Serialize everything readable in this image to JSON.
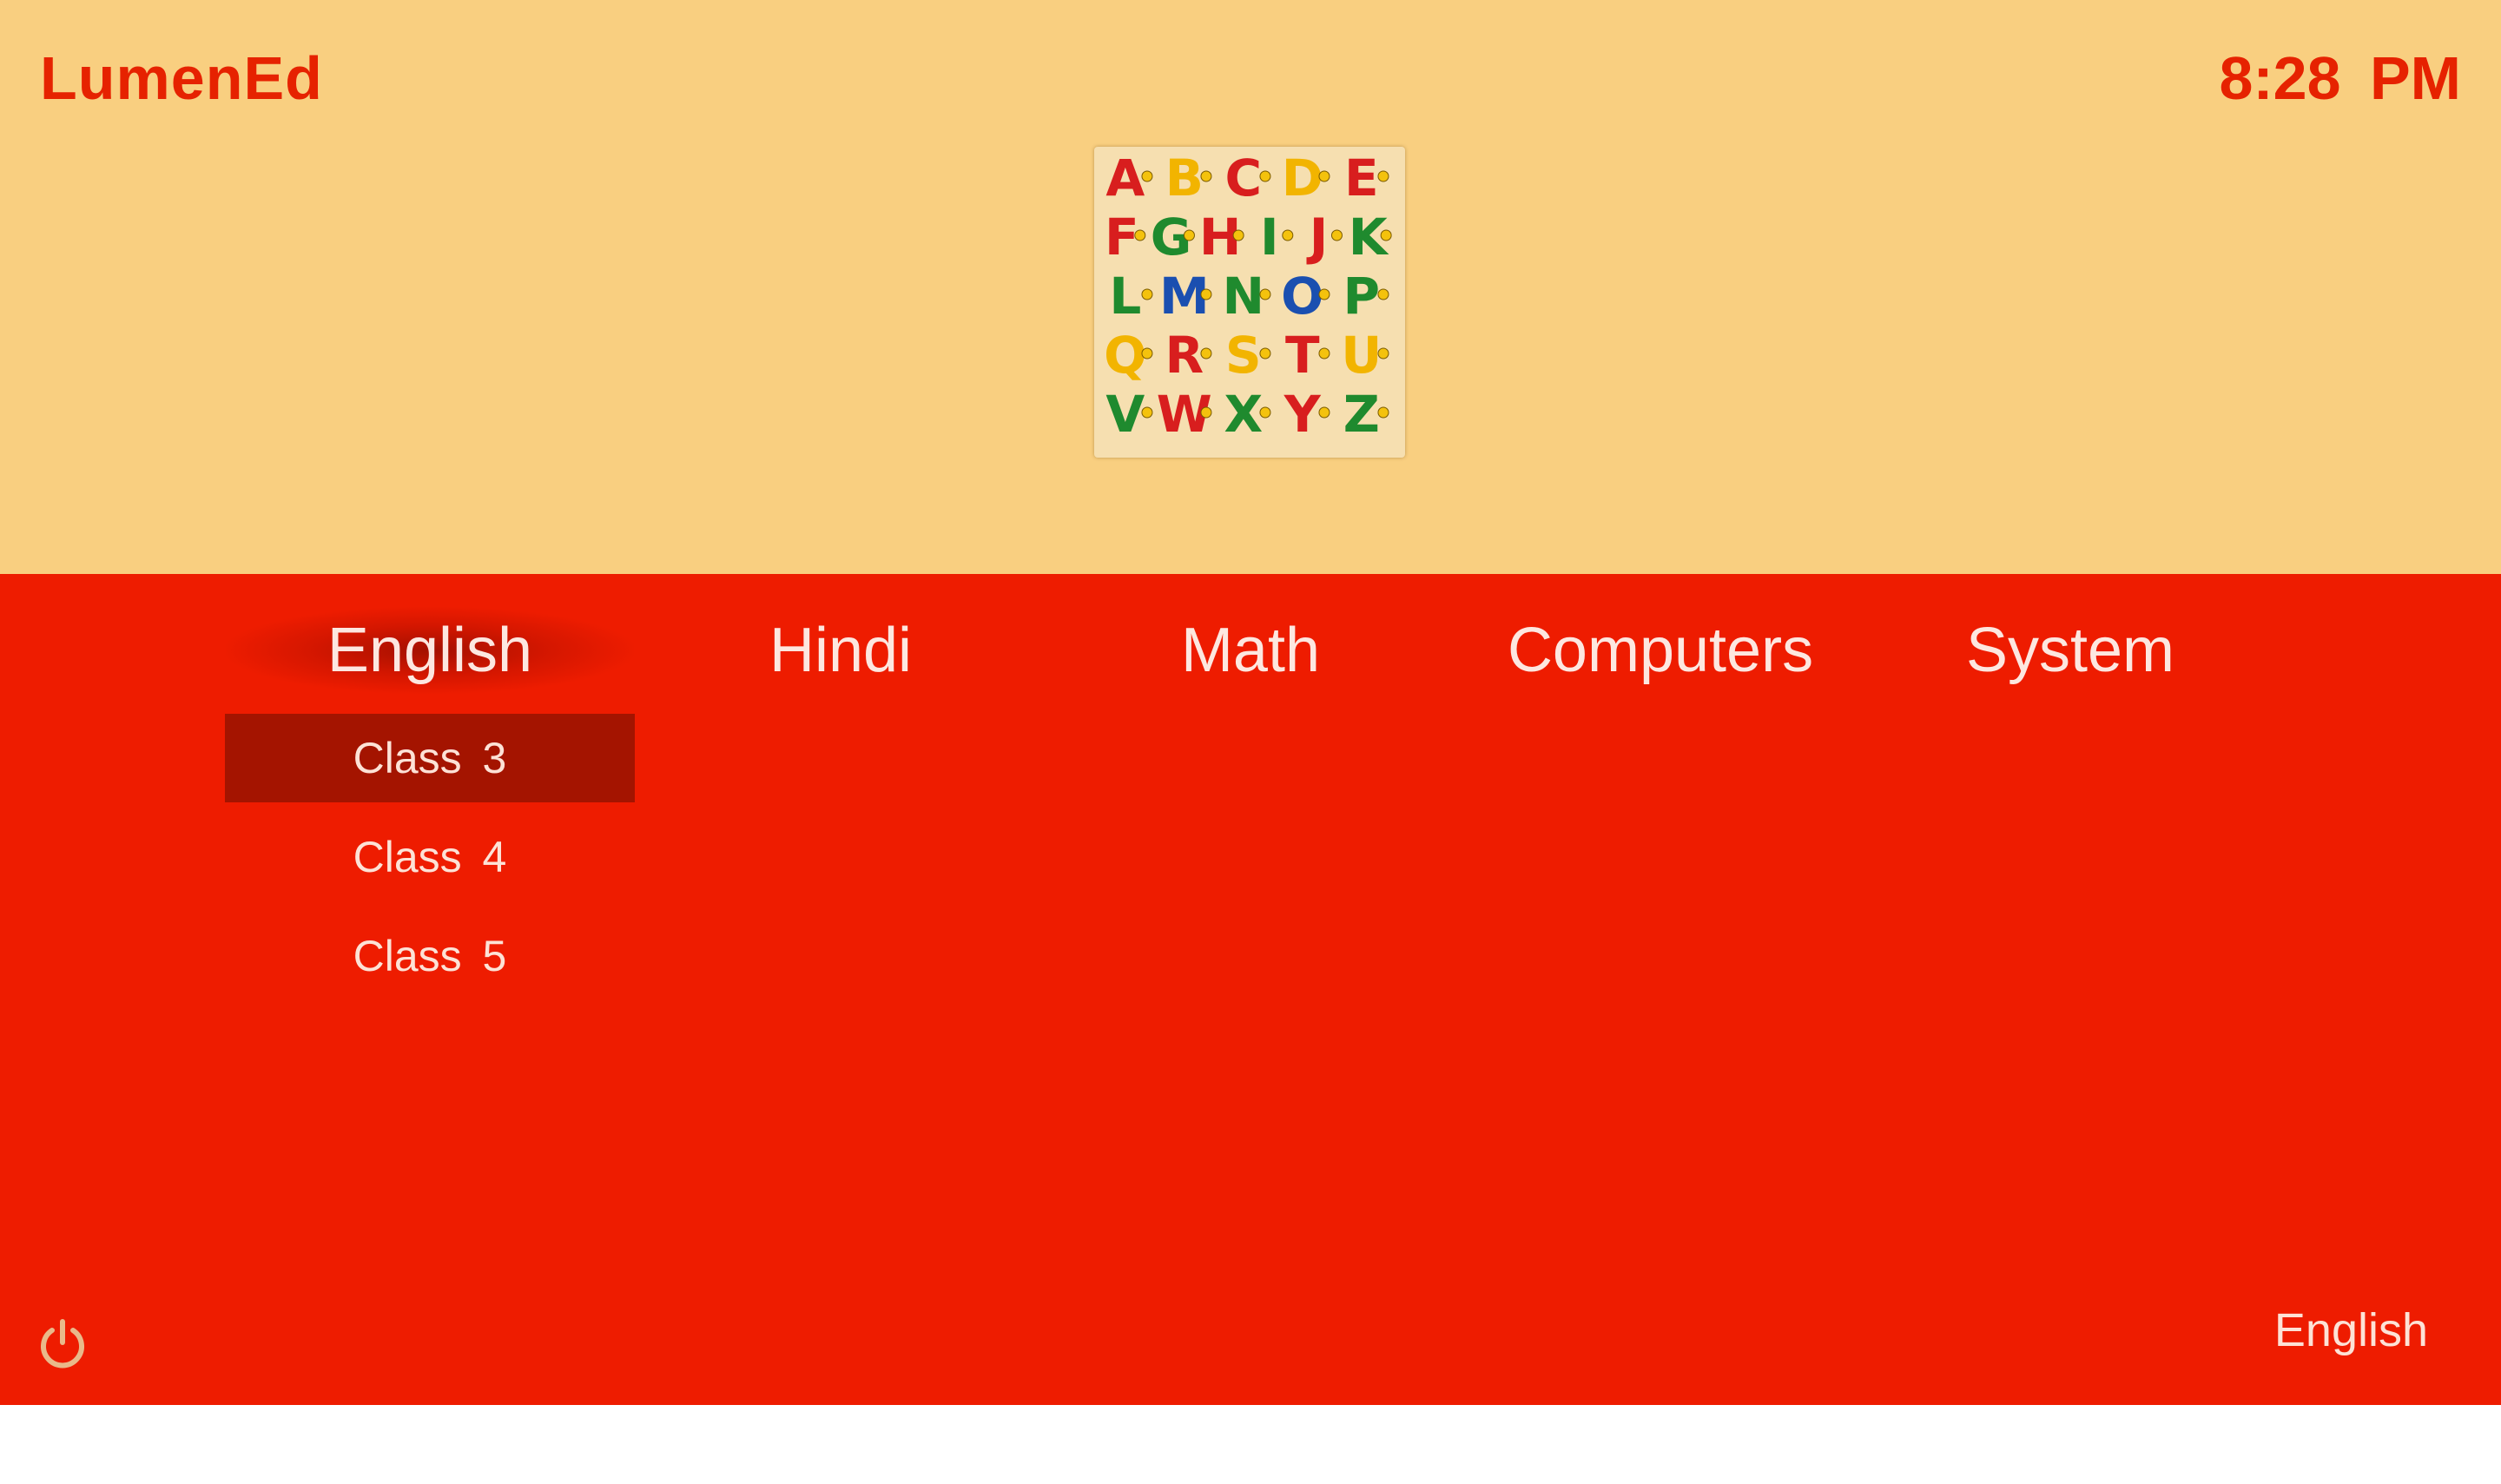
{
  "header": {
    "brand": "LumenEd",
    "time": "8:28 PM",
    "banner_icon": "alphabet-puzzle-image",
    "banner_letters": [
      "A",
      "B",
      "C",
      "D",
      "E",
      "F",
      "G",
      "H",
      "I",
      "J",
      "K",
      "L",
      "M",
      "N",
      "O",
      "P",
      "Q",
      "R",
      "S",
      "T",
      "U",
      "V",
      "W",
      "X",
      "Y",
      "Z"
    ]
  },
  "tabs": [
    {
      "label": "English"
    },
    {
      "label": "Hindi"
    },
    {
      "label": "Math"
    },
    {
      "label": "Computers"
    },
    {
      "label": "System"
    }
  ],
  "active_tab": "English",
  "submenu": {
    "items": [
      {
        "label": "Class 3"
      },
      {
        "label": "Class 4"
      },
      {
        "label": "Class 5"
      }
    ],
    "selected": "Class 3"
  },
  "footer": {
    "power_icon": "power-icon",
    "language": "English"
  },
  "colors": {
    "header_bg": "#f9cf80",
    "main_bg": "#ee1c00",
    "accent_text": "#e62200",
    "selected_bg": "#a41400"
  }
}
